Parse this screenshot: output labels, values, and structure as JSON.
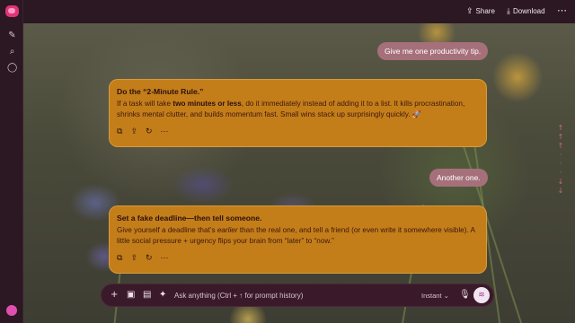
{
  "topbar": {
    "share_label": "Share",
    "download_label": "Download",
    "more_icon": "more-icon"
  },
  "sidebar": {
    "icons": [
      "app-logo",
      "new-chat-icon",
      "search-icon",
      "chat-bubble-icon"
    ],
    "avatar": "avatar"
  },
  "messages": [
    {
      "role": "user",
      "text": "Give me one productivity tip."
    },
    {
      "role": "assistant",
      "title": "Do the “2-Minute Rule.”",
      "body_before": "If a task will take ",
      "body_bold": "two minutes or less",
      "body_after": ", do it immediately instead of adding it to a list. It kills procrastination, shrinks mental clutter, and builds momentum fast. Small wins stack up surprisingly quickly. 🚀"
    },
    {
      "role": "user",
      "text": "Another one."
    },
    {
      "role": "assistant",
      "title": "Set a fake deadline—then tell someone.",
      "body_before": "Give yourself a deadline that’s ",
      "body_em": "earlier",
      "body_after": " than the real one, and tell a friend (or even write it somewhere visible). A little social pressure + urgency flips your brain from “later” to “now.”"
    }
  ],
  "composer": {
    "placeholder": "Ask anything (Ctrl + ↑ for prompt history)",
    "mode": "Instant",
    "mode_chevron": "⌄"
  },
  "colors": {
    "assistant_bubble": "#c47e19",
    "user_bubble": "#a6707a",
    "chrome": "#2b1822",
    "accent": "#e0337a"
  }
}
